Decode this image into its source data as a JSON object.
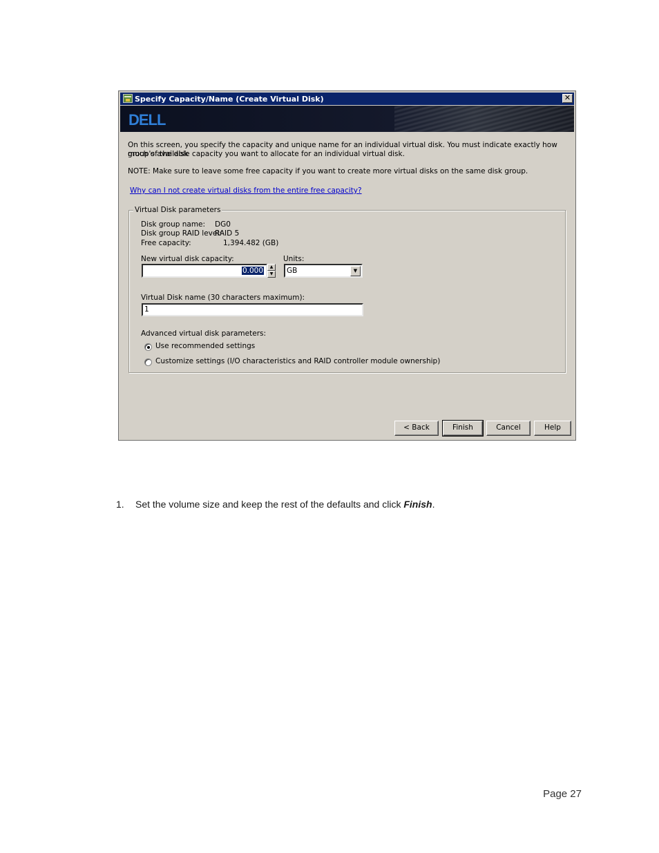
{
  "dialog": {
    "title": "Specify Capacity/Name (Create Virtual Disk)",
    "close_label": "✕",
    "brand": "DELL",
    "intro": [
      "On this screen, you specify the capacity and unique name for an individual virtual disk. You must indicate exactly how much of the disk",
      "group's available capacity you want to allocate for an individual virtual disk."
    ],
    "note": "NOTE: Make sure to leave some free capacity if you want to create more virtual disks on the same disk group.",
    "link": "Why can I not create virtual disks from the entire free capacity?",
    "group": {
      "legend": "Virtual Disk parameters",
      "disk_group_name_label": "Disk group name:",
      "disk_group_name_value": "DG0",
      "raid_level_label": "Disk group RAID level:",
      "raid_level_value": "RAID 5",
      "free_capacity_label": "Free capacity:",
      "free_capacity_value": "1,394.482 (GB)",
      "capacity_label": "New virtual disk capacity:",
      "capacity_value": "0.000",
      "units_label": "Units:",
      "units_value": "GB",
      "name_label": "Virtual Disk name (30 characters maximum):",
      "name_value": "1",
      "advanced_label": "Advanced virtual disk parameters:",
      "option_recommended": "Use recommended settings",
      "option_customize": "Customize settings (I/O characteristics and RAID controller module ownership)"
    },
    "buttons": {
      "back": "< Back",
      "finish": "Finish",
      "cancel": "Cancel",
      "help": "Help"
    }
  },
  "document": {
    "step_number": "1.",
    "step_text_before": "Set the volume size and keep the rest of the defaults and click ",
    "step_text_emphasis": "Finish",
    "step_text_after": ".",
    "page_number": "Page 27"
  }
}
